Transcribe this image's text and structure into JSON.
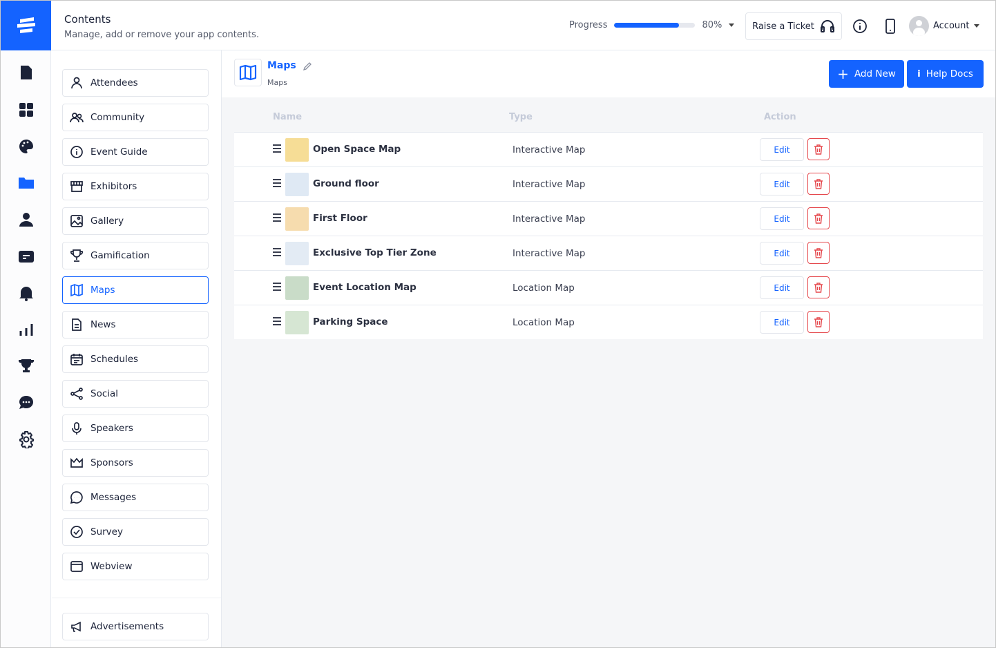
{
  "header": {
    "title": "Contents",
    "subtitle": "Manage, add or remove your app contents.",
    "progress_label": "Progress",
    "progress_value": 80,
    "progress_text": "80%",
    "ticket_label": "Raise a Ticket",
    "account_label": "Account"
  },
  "rail": {
    "items": [
      "file-icon",
      "grid-icon",
      "palette-icon",
      "folder-icon",
      "user-icon",
      "card-icon",
      "bell-icon",
      "chart-icon",
      "trophy-icon",
      "chat-icon",
      "gear-icon"
    ],
    "active": "folder-icon"
  },
  "sidebar": {
    "items": [
      {
        "label": "Attendees",
        "icon": "person-icon"
      },
      {
        "label": "Community",
        "icon": "people-icon"
      },
      {
        "label": "Event Guide",
        "icon": "info-icon"
      },
      {
        "label": "Exhibitors",
        "icon": "store-icon"
      },
      {
        "label": "Gallery",
        "icon": "image-icon"
      },
      {
        "label": "Gamification",
        "icon": "trophy-icon"
      },
      {
        "label": "Maps",
        "icon": "map-icon",
        "active": true
      },
      {
        "label": "News",
        "icon": "document-icon"
      },
      {
        "label": "Schedules",
        "icon": "calendar-icon"
      },
      {
        "label": "Social",
        "icon": "share-icon"
      },
      {
        "label": "Speakers",
        "icon": "microphone-icon"
      },
      {
        "label": "Sponsors",
        "icon": "crown-icon"
      },
      {
        "label": "Messages",
        "icon": "message-icon"
      },
      {
        "label": "Survey",
        "icon": "check-circle-icon"
      },
      {
        "label": "Webview",
        "icon": "browser-icon"
      }
    ],
    "advertisements": "Advertisements"
  },
  "main": {
    "title": "Maps",
    "breadcrumb": "Maps",
    "add_new": "Add New",
    "help_docs": "Help Docs",
    "columns": {
      "name": "Name",
      "type": "Type",
      "action": "Action"
    },
    "edit_label": "Edit",
    "rows": [
      {
        "name": "Open Space Map",
        "type": "Interactive Map",
        "thumb": "#f6dd96"
      },
      {
        "name": "Ground floor",
        "type": "Interactive Map",
        "thumb": "#dfe9f4"
      },
      {
        "name": "First Floor",
        "type": "Interactive Map",
        "thumb": "#f6dcae"
      },
      {
        "name": "Exclusive Top Tier Zone",
        "type": "Interactive Map",
        "thumb": "#e3ebf4"
      },
      {
        "name": "Event Location Map",
        "type": "Location Map",
        "thumb": "#c9dcc8"
      },
      {
        "name": "Parking Space",
        "type": "Location Map",
        "thumb": "#d6e6d3"
      }
    ]
  },
  "colors": {
    "accent": "#1463ff",
    "danger": "#e5484d",
    "text": "#1b2238"
  }
}
